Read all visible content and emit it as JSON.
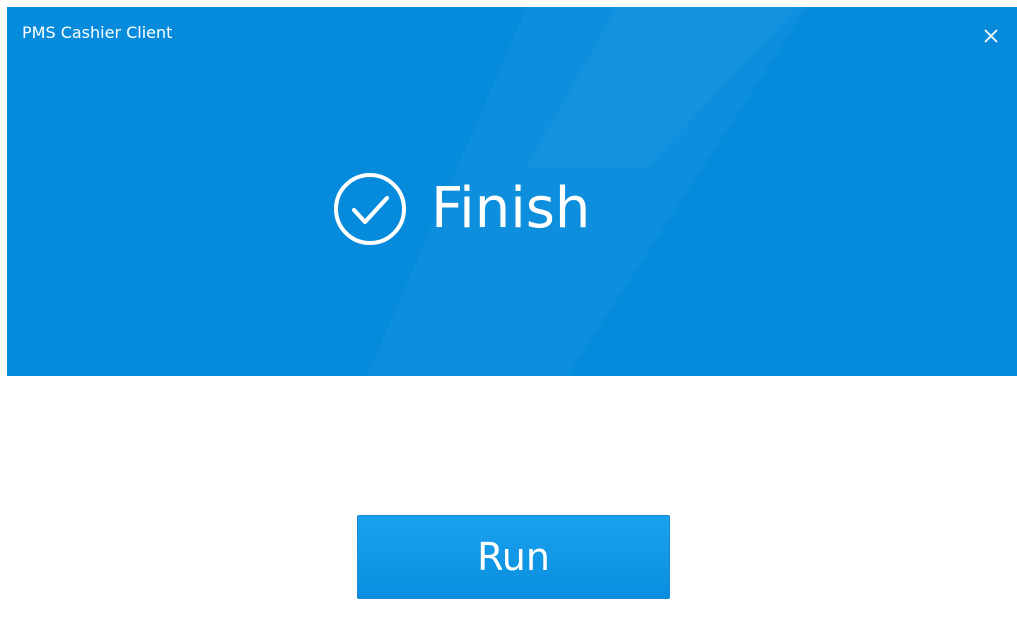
{
  "window": {
    "title": "PMS Cashier Client"
  },
  "banner": {
    "status_text": "Finish",
    "status_icon": "check-circle-icon",
    "close_icon": "close-icon",
    "colors": {
      "banner_background": "#068bdc",
      "text": "#ffffff"
    }
  },
  "actions": {
    "run_label": "Run",
    "run_button_color": "#0a8ee0"
  }
}
